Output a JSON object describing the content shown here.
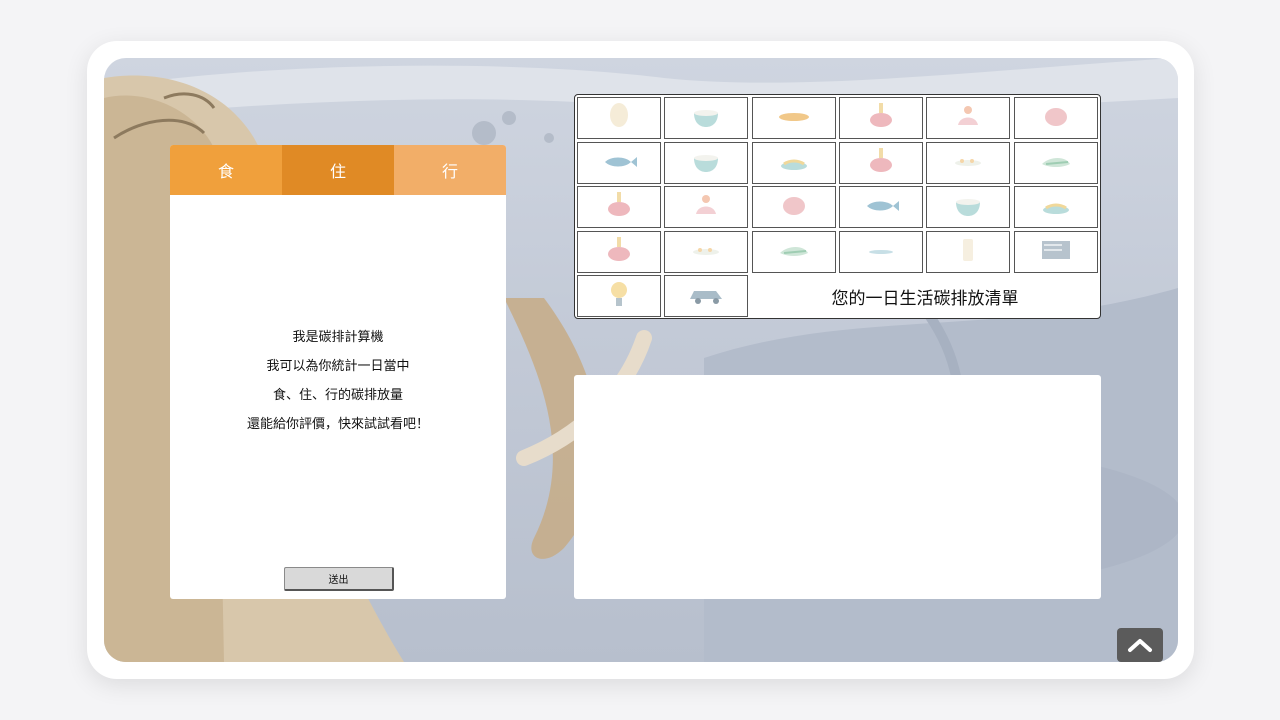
{
  "tabs": [
    {
      "label": "食"
    },
    {
      "label": "住"
    },
    {
      "label": "行"
    }
  ],
  "intro_lines": [
    "我是碳排計算機",
    "我可以為你統計一日當中",
    "食、住、行的碳排放量",
    "還能給你評價，快來試試看吧！"
  ],
  "send_label": "送出",
  "grid_title": "您的一日生活碳排放清單",
  "grid_items": [
    "egg-icon",
    "rice-bowl-icon",
    "bread-icon",
    "steak-icon",
    "chicken-icon",
    "pork-icon",
    "fish-icon",
    "rice-bowl-icon",
    "noodles-icon",
    "steak-icon",
    "shrimp-icon",
    "greens-icon",
    "steak-icon",
    "chicken-icon",
    "pork-icon",
    "fish-icon",
    "rice-bowl-icon",
    "noodles-icon",
    "steak-icon",
    "shrimp-icon",
    "greens-icon",
    "dish-icon",
    "milk-icon",
    "air-conditioner-icon",
    "light-bulb-icon",
    "car-icon"
  ],
  "colors": {
    "tab_food": "#f0a03c",
    "tab_home": "#e08a25",
    "tab_transport": "#f2ae68"
  }
}
